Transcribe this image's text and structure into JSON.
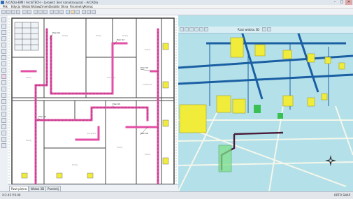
{
  "window": {
    "title": "ArCADia-BIM / ArchiTECH – [projekt: Sieć kanalizacyjna] – ArCADia",
    "minimize_label": "–",
    "maximize_label": "□",
    "close_label": "✕"
  },
  "menubar": {
    "items": [
      "Plik",
      "Edycja",
      "Widok",
      "Wstaw",
      "Zmień",
      "Dodatki",
      "Okna",
      "Parametry",
      "Pomoc"
    ]
  },
  "plan": {
    "room_labels": [
      "Pokój",
      "Pokój",
      "Pokój",
      "Pokój",
      "Pokój",
      "Kuchnia",
      "Łazienka",
      "Korytarz",
      "Pokój",
      "Pokój",
      "Pokój",
      "Pokój"
    ],
    "tag_labels": [
      "Pion K1",
      "Pion K2",
      "Pion K3",
      "Pion K4",
      "Pion K5",
      "Pion K6"
    ]
  },
  "view3d": {
    "toolbar_label": "Rzut widoku 3D"
  },
  "tabs": {
    "items": [
      "Rzut piętra",
      "Widok 3D",
      "Przekrój"
    ]
  },
  "status": {
    "coords": "X:2.45  Y:0.00",
    "right": "ORTO  SNAP"
  },
  "colors": {
    "pipe_primary": "#e24fa4",
    "pipe_dark": "#7a1f54",
    "fixture": "#f1ec3a",
    "floor": "#b4e0ea",
    "duct": "#1b5fa3"
  }
}
